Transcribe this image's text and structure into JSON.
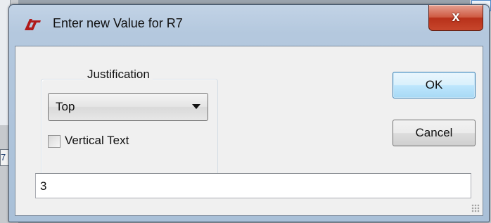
{
  "dialog": {
    "title": "Enter new Value for R7",
    "close_label": "x",
    "justification": {
      "label": "Justification",
      "selected": "Top"
    },
    "vertical_text": {
      "label": "Vertical Text",
      "checked": false
    },
    "ok_label": "OK",
    "cancel_label": "Cancel",
    "value": "3"
  },
  "background": {
    "left_tab_text": "7"
  },
  "colors": {
    "titlebar": "#b4c8de",
    "close_button": "#c7462c",
    "default_button_border": "#3c7fb1",
    "client_area": "#f0f0f0"
  },
  "icons": {
    "app": "ltspice-logo-icon",
    "close": "close-icon",
    "dropdown": "chevron-down-icon"
  }
}
